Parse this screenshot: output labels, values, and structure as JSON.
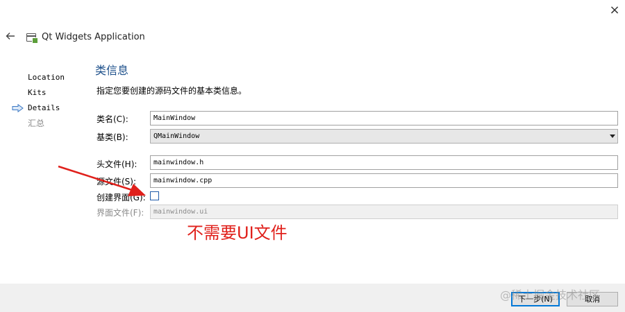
{
  "window": {
    "close_icon": "×",
    "title": "Qt Widgets Application"
  },
  "nav": {
    "items": [
      {
        "label": "Location",
        "state": "done"
      },
      {
        "label": "Kits",
        "state": "done"
      },
      {
        "label": "Details",
        "state": "current"
      },
      {
        "label": "汇总",
        "state": "pending"
      }
    ]
  },
  "page": {
    "heading": "类信息",
    "description": "指定您要创建的源码文件的基本类信息。"
  },
  "form": {
    "class_name": {
      "label": "类名(C):",
      "value": "MainWindow"
    },
    "base_class": {
      "label": "基类(B):",
      "value": "QMainWindow"
    },
    "header_file": {
      "label": "头文件(H):",
      "value": "mainwindow.h"
    },
    "source_file": {
      "label": "源文件(S):",
      "value": "mainwindow.cpp"
    },
    "generate_form": {
      "label": "创建界面(G):",
      "checked": false
    },
    "form_file": {
      "label": "界面文件(F):",
      "value": "mainwindow.ui"
    }
  },
  "annotation": {
    "text": "不需要UI文件",
    "color": "#e0201b"
  },
  "buttons": {
    "next": "下一步(N)",
    "cancel": "取消"
  },
  "watermark": "@稀土掘金技术社区",
  "colors": {
    "heading": "#1c4f8a",
    "checkbox_border": "#1e5aa8",
    "primary_button_border": "#0078d7"
  }
}
